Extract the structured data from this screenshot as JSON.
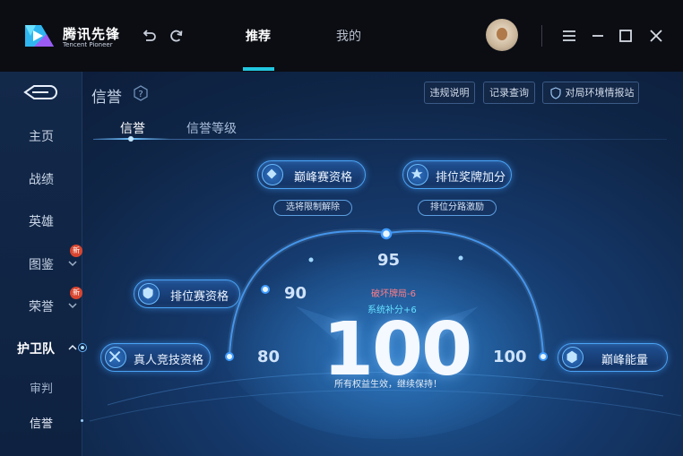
{
  "app": {
    "logo_cn": "腾讯先锋",
    "logo_en": "Tencent Pioneer"
  },
  "nav": {
    "tabs": [
      {
        "label": "推荐",
        "active": true
      },
      {
        "label": "我的",
        "active": false
      }
    ]
  },
  "sidebar": {
    "items": [
      {
        "label": "主页"
      },
      {
        "label": "战绩"
      },
      {
        "label": "英雄"
      },
      {
        "label": "图鉴",
        "badge": "新"
      },
      {
        "label": "荣誉",
        "badge": "新"
      },
      {
        "label": "护卫队",
        "active": true
      }
    ],
    "subitems": [
      {
        "label": "审判"
      },
      {
        "label": "信誉",
        "active": true
      }
    ]
  },
  "page": {
    "title": "信誉",
    "buttons": {
      "violation": "违规说明",
      "records": "记录查询",
      "report": "对局环境情报站"
    },
    "tabs": [
      {
        "label": "信誉",
        "active": true
      },
      {
        "label": "信誉等级",
        "active": false
      }
    ]
  },
  "benefits": {
    "peak": "巅峰赛资格",
    "rank_reward": "排位奖牌加分",
    "pick_unlock": "选将限制解除",
    "lane_incentive": "排位分路激励",
    "ranked": "排位赛资格",
    "real_match": "真人竞技资格",
    "peak_energy": "巅峰能量"
  },
  "score": {
    "value": "100",
    "max": 100,
    "ticks": [
      "80",
      "90",
      "95",
      "100"
    ],
    "penalty": "破坏牌局-6",
    "bonus": "系统补分+6",
    "status": "所有权益生效，继续保持！"
  },
  "colors": {
    "accent": "#22c7e0",
    "glow": "#4aa3f5",
    "penalty": "#ff7d88",
    "bonus": "#64e0ff"
  }
}
